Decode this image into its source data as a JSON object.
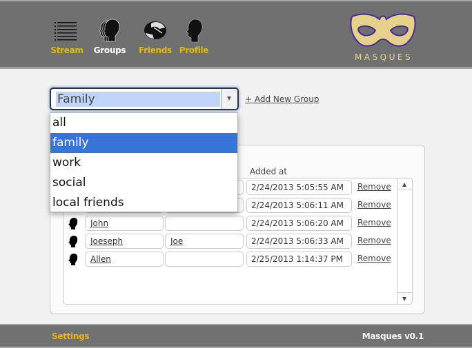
{
  "header": {
    "nav": [
      {
        "id": "stream",
        "label": "Stream",
        "icon": "list-icon",
        "active": false
      },
      {
        "id": "groups",
        "label": "Groups",
        "icon": "group-heads-icon",
        "active": true
      },
      {
        "id": "friends",
        "label": "Friends",
        "icon": "handshake-icon",
        "active": false
      },
      {
        "id": "profile",
        "label": "Profile",
        "icon": "head-silhouette-icon",
        "active": false
      }
    ],
    "logo_text": "MASQUES"
  },
  "group_select": {
    "selected": "Family",
    "options": [
      "all",
      "family",
      "work",
      "social",
      "local friends"
    ],
    "highlighted_option": "family",
    "add_group_label": "+ Add New Group"
  },
  "members_table": {
    "column_headers": {
      "added_at": "Added at"
    },
    "rows": [
      {
        "name": "",
        "nickname": "",
        "added_at": "2/24/2013 5:05:55 AM",
        "action": "Remove"
      },
      {
        "name": "",
        "nickname": "",
        "added_at": "2/24/2013 5:06:11 AM",
        "action": "Remove"
      },
      {
        "name": "John",
        "nickname": "",
        "added_at": "2/24/2013 5:06:20 AM",
        "action": "Remove"
      },
      {
        "name": "Joeseph",
        "nickname": "Joe",
        "added_at": "2/24/2013 5:06:33 AM",
        "action": "Remove"
      },
      {
        "name": "Allen",
        "nickname": "",
        "added_at": "2/25/2013 1:14:37 PM",
        "action": "Remove"
      }
    ]
  },
  "footer": {
    "settings_label": "Settings",
    "version": "Masques v0.1"
  },
  "colors": {
    "header_bg": "#707070",
    "nav_accent": "#e8b800",
    "nav_active": "#ffffff",
    "logo_mask": "#e6d18a",
    "logo_outline": "#4b2a9a",
    "selection_blue": "#3874d8"
  }
}
